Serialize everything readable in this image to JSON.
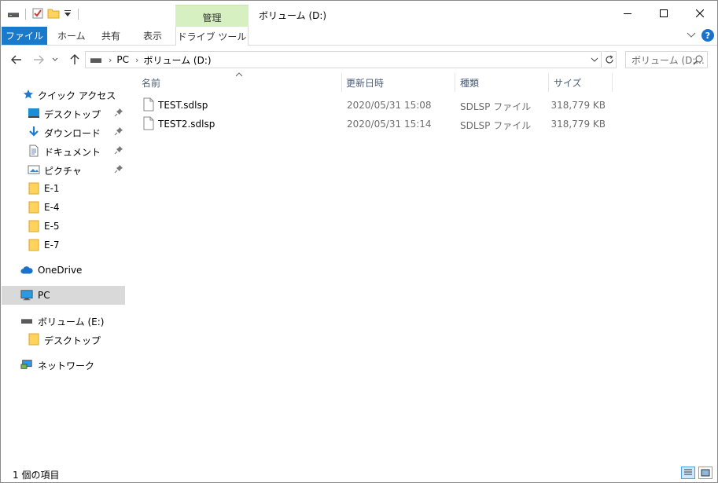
{
  "window": {
    "title": "ボリューム (D:)",
    "context_group": "管理",
    "buttons": {
      "minimize": "—",
      "maximize": "☐",
      "close": "✕"
    }
  },
  "ribbon": {
    "tabs": [
      {
        "label": "ファイル",
        "active": true
      },
      {
        "label": "ホーム"
      },
      {
        "label": "共有"
      },
      {
        "label": "表示"
      },
      {
        "label": "ドライブ ツール"
      }
    ]
  },
  "address": {
    "breadcrumb": [
      "PC",
      "ボリューム (D:)"
    ],
    "search_placeholder": "ボリューム (D:...",
    "nav_back": "←",
    "nav_forward": "→",
    "nav_up": "↑"
  },
  "navigation": {
    "quick_access": "クイック アクセス",
    "pinned": [
      {
        "label": "デスクトップ",
        "icon": "desktop-icon"
      },
      {
        "label": "ダウンロード",
        "icon": "download-icon"
      },
      {
        "label": "ドキュメント",
        "icon": "document-icon"
      },
      {
        "label": "ピクチャ",
        "icon": "picture-icon"
      }
    ],
    "folders": [
      {
        "label": "E-1"
      },
      {
        "label": "E-4"
      },
      {
        "label": "E-5"
      },
      {
        "label": "E-7"
      }
    ],
    "onedrive": "OneDrive",
    "pc": "PC",
    "volume_e": "ボリューム (E:)",
    "volume_e_child": "デスクトップ",
    "network": "ネットワーク"
  },
  "columns": {
    "name": "名前",
    "date": "更新日時",
    "type": "種類",
    "size": "サイズ"
  },
  "files": [
    {
      "name": "TEST.sdlsp",
      "date": "2020/05/31 15:08",
      "type": "SDLSP ファイル",
      "size": "318,779 KB"
    },
    {
      "name": "TEST2.sdlsp",
      "date": "2020/05/31 15:14",
      "type": "SDLSP ファイル",
      "size": "318,779 KB"
    }
  ],
  "status": {
    "item_count": "1 個の項目"
  },
  "colors": {
    "file_tab": "#1979ca",
    "context_tab": "#d6f0c2",
    "selected_nav": "#d9d9d9",
    "column_header_text": "#4c607a"
  }
}
